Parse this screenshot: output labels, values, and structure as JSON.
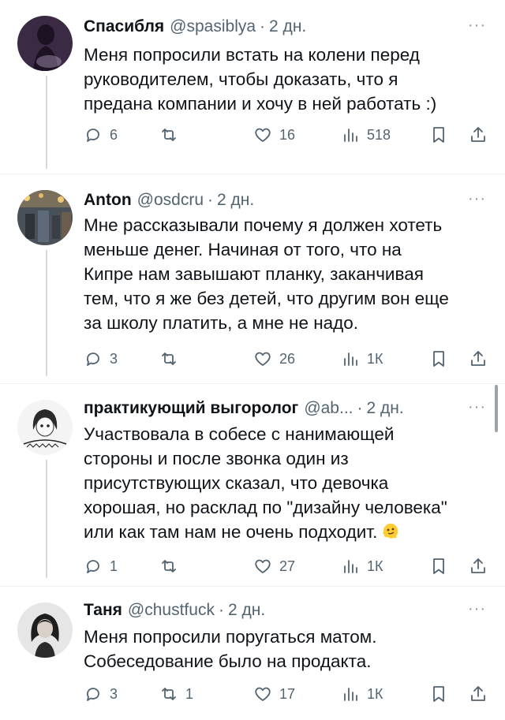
{
  "tweets": [
    {
      "name": "Спасибля",
      "handle": "@spasiblya",
      "dot": "·",
      "time": "2 дн.",
      "lines": [
        "Меня попросили встать на колени перед",
        "руководителем, чтобы доказать, что я",
        "предана компании и хочу в ней работать :)"
      ],
      "replies": "6",
      "retweets": "",
      "likes": "16",
      "views": "518"
    },
    {
      "name": "Anton",
      "handle": "@osdcru",
      "dot": "·",
      "time": "2 дн.",
      "lines": [
        "Мне рассказывали почему я должен хотеть",
        "меньше денег. Начиная от того, что на",
        "Кипре нам завышают планку, заканчивая",
        "тем, что я же без детей, что другим вон еще",
        "за школу платить, а мне не надо."
      ],
      "replies": "3",
      "retweets": "",
      "likes": "26",
      "views": "1К"
    },
    {
      "name": "практикующий выгоролог",
      "handle": "@ab...",
      "dot": "·",
      "time": "2 дн.",
      "lines": [
        "Участвовала в собесе с нанимающей",
        "стороны и после звонка один из",
        "присутствующих сказал, что девочка",
        "хорошая, но расклад по \"дизайну человека\"",
        "или как там нам не очень подходит."
      ],
      "replies": "1",
      "retweets": "",
      "likes": "27",
      "views": "1К"
    },
    {
      "name": "Таня",
      "handle": "@chustfuck",
      "dot": "·",
      "time": "2 дн.",
      "lines": [
        "Меня попросили поругаться матом.",
        "Собеседование было на продакта."
      ],
      "replies": "3",
      "retweets": "1",
      "likes": "17",
      "views": "1К"
    }
  ],
  "more_label": "···",
  "icons": {
    "reply": "reply-icon",
    "retweet": "retweet-icon",
    "like": "heart-icon",
    "views": "views-icon",
    "bookmark": "bookmark-icon",
    "share": "share-icon",
    "emoji": "melting-face-emoji"
  },
  "colors": {
    "text": "#0f1419",
    "secondary": "#536471",
    "divider": "#eff3f4",
    "thread_line": "#cfd9de"
  }
}
